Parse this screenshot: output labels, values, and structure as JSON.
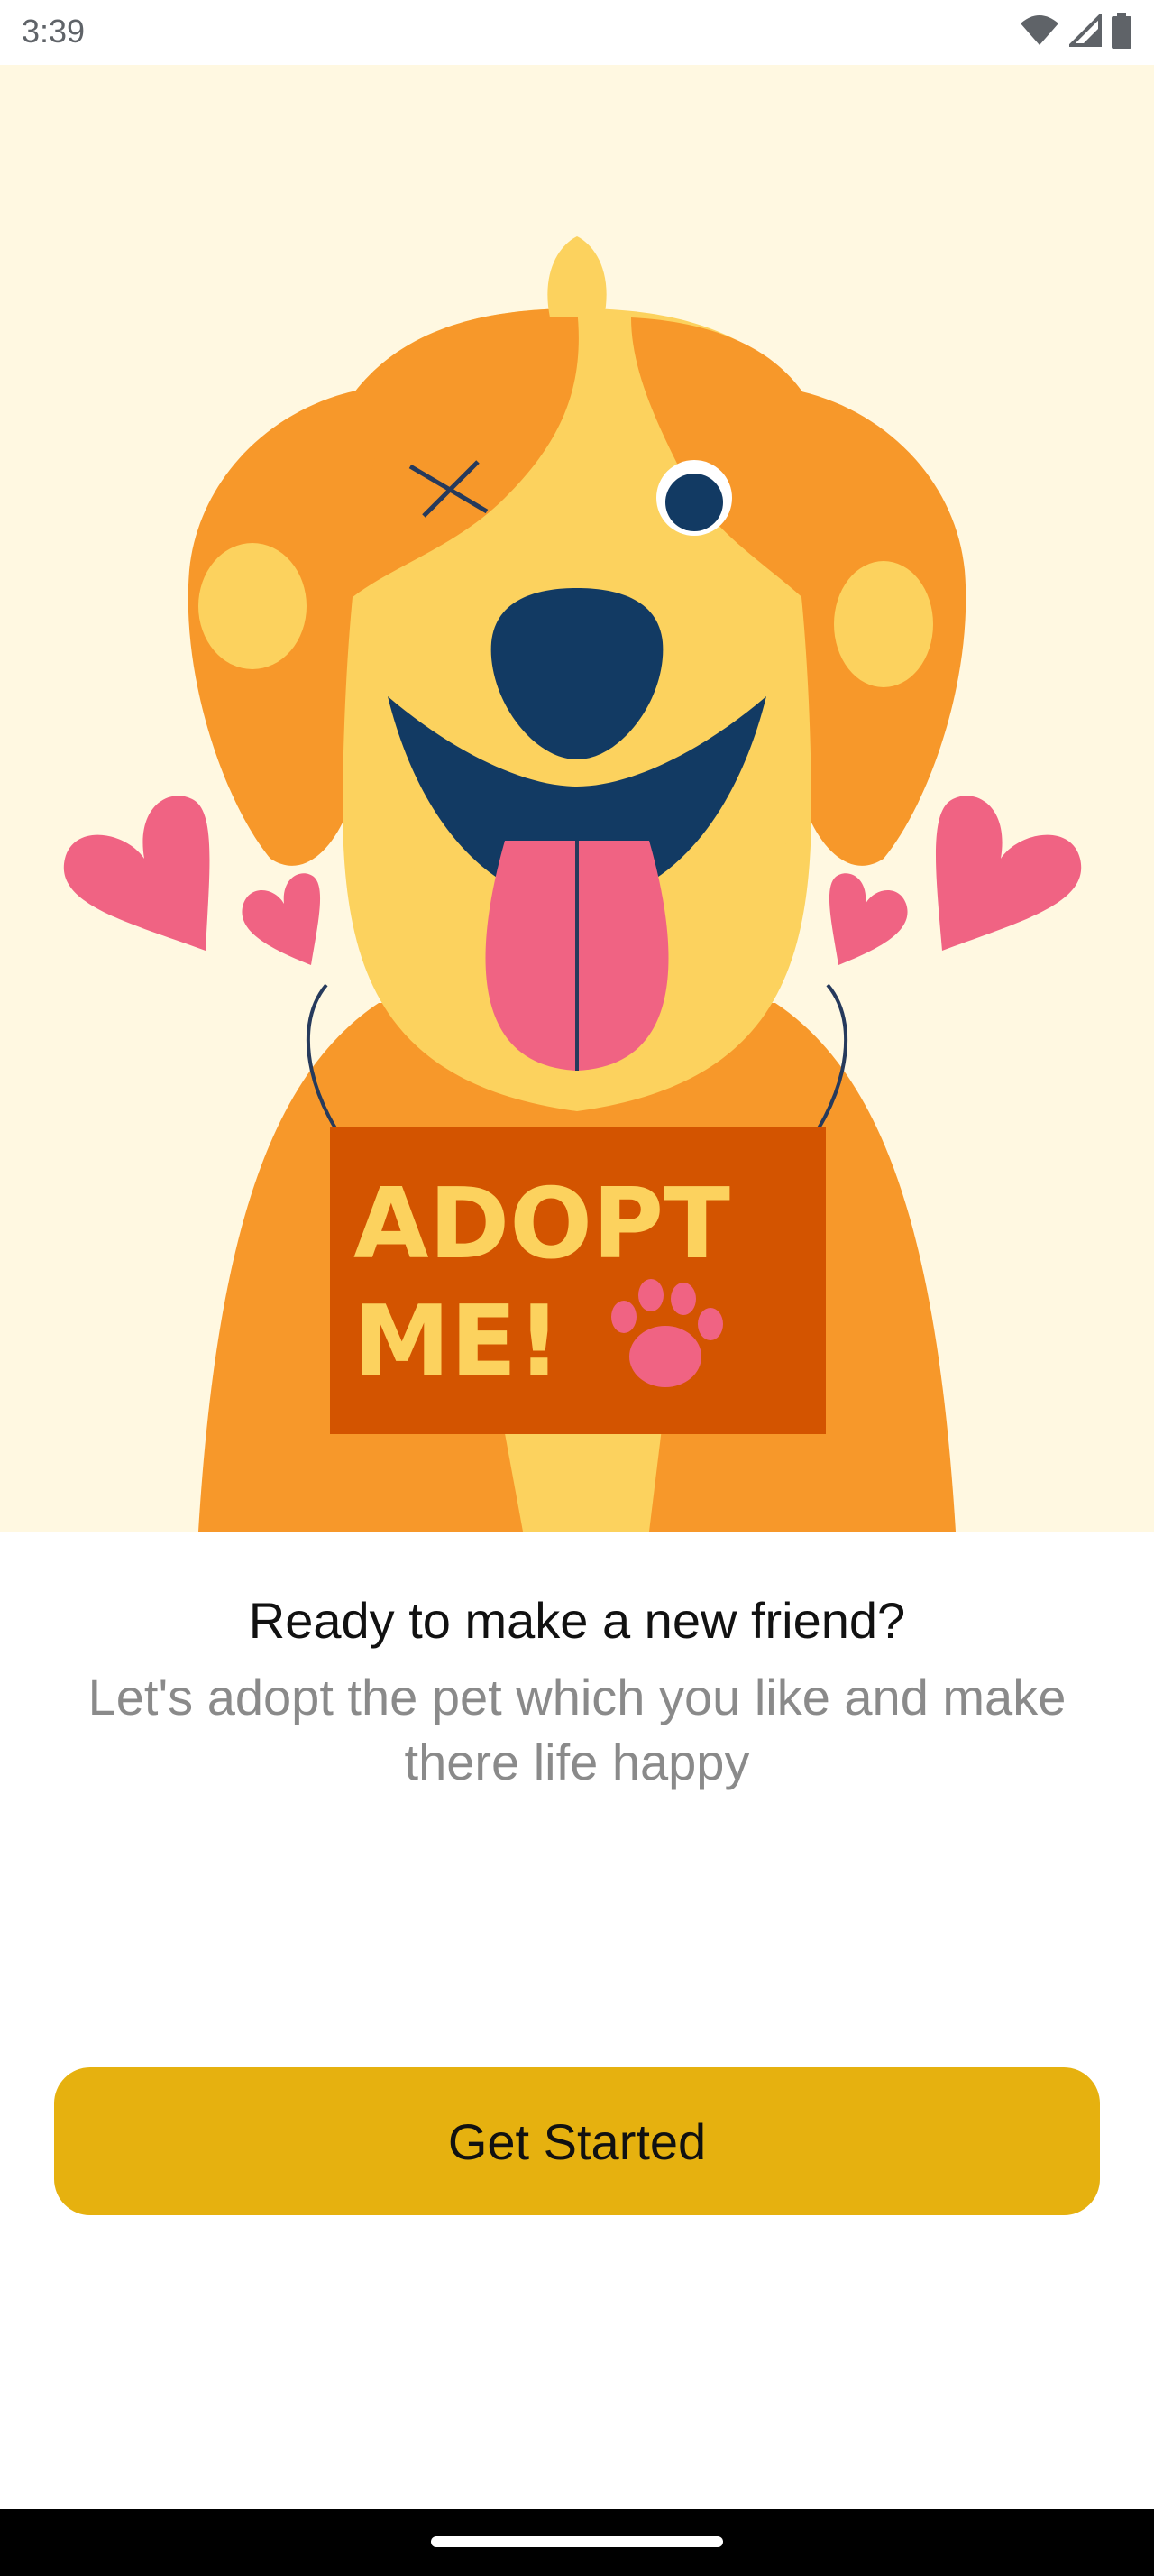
{
  "status_bar": {
    "time": "3:39",
    "icons": [
      "wifi-icon",
      "signal-icon",
      "battery-icon"
    ]
  },
  "hero": {
    "image": "adopt-me-dog-illustration",
    "sign_text_line1": "ADOPT",
    "sign_text_line2": "ME!"
  },
  "onboarding": {
    "title": "Ready to make a new friend?",
    "subtitle": "Let's adopt the pet which you like and make there life happy",
    "cta_label": "Get Started"
  },
  "colors": {
    "accent": "#e6b10f",
    "hero_background": "#fff8e1",
    "subtitle_text": "#8a8a8a"
  }
}
